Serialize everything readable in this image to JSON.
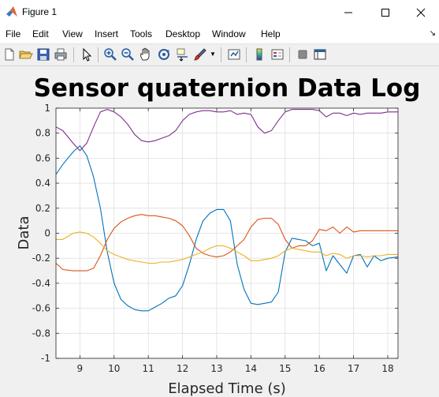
{
  "window": {
    "title": "Figure 1"
  },
  "menu": [
    "File",
    "Edit",
    "View",
    "Insert",
    "Tools",
    "Desktop",
    "Window",
    "Help"
  ],
  "toolbar": {
    "icons": [
      "new-figure-icon",
      "open-file-icon",
      "save-icon",
      "print-icon",
      "select-arrow-icon",
      "zoom-in-icon",
      "zoom-out-icon",
      "pan-hand-icon",
      "rotate-3d-icon",
      "data-cursor-icon",
      "brush-icon",
      "link-plot-icon",
      "colorbar-icon",
      "legend-icon",
      "hide-plot-tools-icon",
      "show-plot-tools-icon"
    ]
  },
  "chart_data": {
    "type": "line",
    "title": "Sensor quaternion Data Log",
    "xlabel": "Elapsed Time (s)",
    "ylabel": "Data",
    "xlim": [
      8.3,
      18.3
    ],
    "ylim": [
      -1,
      1
    ],
    "xticks": [
      9,
      10,
      11,
      12,
      13,
      14,
      15,
      16,
      17,
      18
    ],
    "yticks": [
      -1,
      -0.8,
      -0.6,
      -0.4,
      -0.2,
      0,
      0.2,
      0.4,
      0.6,
      0.8,
      1
    ],
    "ytick_labels": [
      "-1",
      "-0.8",
      "-0.6",
      "-0.4",
      "-0.2",
      "0",
      "0.2",
      "0.4",
      "0.6",
      "0.8",
      "1"
    ],
    "grid": true,
    "series": [
      {
        "color": "#0072BD",
        "x": [
          8.3,
          8.5,
          8.8,
          9.0,
          9.2,
          9.4,
          9.6,
          9.8,
          10.0,
          10.2,
          10.4,
          10.6,
          10.8,
          11.0,
          11.2,
          11.4,
          11.6,
          11.8,
          12.0,
          12.2,
          12.4,
          12.6,
          12.8,
          13.0,
          13.2,
          13.4,
          13.6,
          13.8,
          14.0,
          14.2,
          14.4,
          14.6,
          14.8,
          15.0,
          15.2,
          15.4,
          15.6,
          15.8,
          16.0,
          16.2,
          16.4,
          16.6,
          16.8,
          17.0,
          17.2,
          17.4,
          17.6,
          17.8,
          18.0,
          18.3
        ],
        "y": [
          0.47,
          0.55,
          0.65,
          0.7,
          0.62,
          0.45,
          0.2,
          -0.15,
          -0.4,
          -0.53,
          -0.58,
          -0.61,
          -0.62,
          -0.62,
          -0.59,
          -0.56,
          -0.52,
          -0.5,
          -0.42,
          -0.25,
          -0.05,
          0.1,
          0.16,
          0.19,
          0.19,
          0.1,
          -0.25,
          -0.45,
          -0.56,
          -0.57,
          -0.56,
          -0.55,
          -0.47,
          -0.15,
          -0.04,
          -0.05,
          -0.06,
          -0.1,
          -0.08,
          -0.3,
          -0.18,
          -0.25,
          -0.32,
          -0.18,
          -0.17,
          -0.27,
          -0.18,
          -0.22,
          -0.2,
          -0.19
        ]
      },
      {
        "color": "#D95319",
        "x": [
          8.3,
          8.5,
          8.8,
          9.0,
          9.2,
          9.4,
          9.6,
          9.8,
          10.0,
          10.2,
          10.4,
          10.6,
          10.8,
          11.0,
          11.2,
          11.4,
          11.6,
          11.8,
          12.0,
          12.2,
          12.4,
          12.6,
          12.8,
          13.0,
          13.2,
          13.4,
          13.6,
          13.8,
          14.0,
          14.2,
          14.4,
          14.6,
          14.8,
          15.0,
          15.2,
          15.4,
          15.6,
          15.8,
          16.0,
          16.2,
          16.4,
          16.6,
          16.8,
          17.0,
          17.2,
          17.4,
          17.6,
          17.8,
          18.0,
          18.3
        ],
        "y": [
          -0.24,
          -0.29,
          -0.3,
          -0.3,
          -0.3,
          -0.28,
          -0.18,
          -0.05,
          0.04,
          0.09,
          0.12,
          0.14,
          0.15,
          0.14,
          0.14,
          0.13,
          0.12,
          0.1,
          0.06,
          -0.02,
          -0.12,
          -0.16,
          -0.18,
          -0.19,
          -0.18,
          -0.15,
          -0.1,
          -0.05,
          0.05,
          0.11,
          0.12,
          0.12,
          0.07,
          -0.05,
          -0.12,
          -0.1,
          -0.1,
          -0.06,
          0.03,
          0.02,
          0.05,
          0.0,
          0.05,
          0.01,
          0.02,
          0.02,
          0.02,
          0.02,
          0.02,
          0.02
        ]
      },
      {
        "color": "#EDB120",
        "x": [
          8.3,
          8.5,
          8.8,
          9.0,
          9.2,
          9.4,
          9.6,
          9.8,
          10.0,
          10.2,
          10.4,
          10.6,
          10.8,
          11.0,
          11.2,
          11.4,
          11.6,
          11.8,
          12.0,
          12.2,
          12.4,
          12.6,
          12.8,
          13.0,
          13.2,
          13.4,
          13.6,
          13.8,
          14.0,
          14.2,
          14.4,
          14.6,
          14.8,
          15.0,
          15.2,
          15.4,
          15.6,
          15.8,
          16.0,
          16.2,
          16.4,
          16.6,
          16.8,
          17.0,
          17.2,
          17.4,
          17.6,
          17.8,
          18.0,
          18.3
        ],
        "y": [
          -0.05,
          -0.05,
          0.0,
          0.01,
          0.0,
          -0.03,
          -0.08,
          -0.14,
          -0.17,
          -0.19,
          -0.21,
          -0.22,
          -0.23,
          -0.24,
          -0.24,
          -0.23,
          -0.23,
          -0.22,
          -0.21,
          -0.19,
          -0.17,
          -0.15,
          -0.12,
          -0.1,
          -0.1,
          -0.12,
          -0.15,
          -0.18,
          -0.22,
          -0.22,
          -0.21,
          -0.2,
          -0.18,
          -0.14,
          -0.12,
          -0.13,
          -0.14,
          -0.15,
          -0.15,
          -0.18,
          -0.16,
          -0.17,
          -0.2,
          -0.18,
          -0.18,
          -0.19,
          -0.18,
          -0.18,
          -0.17,
          -0.17
        ]
      },
      {
        "color": "#7E2F8E",
        "x": [
          8.3,
          8.5,
          8.8,
          9.0,
          9.2,
          9.4,
          9.6,
          9.8,
          10.0,
          10.2,
          10.4,
          10.6,
          10.8,
          11.0,
          11.2,
          11.4,
          11.6,
          11.8,
          12.0,
          12.2,
          12.4,
          12.6,
          12.8,
          13.0,
          13.2,
          13.4,
          13.6,
          13.8,
          14.0,
          14.2,
          14.4,
          14.6,
          14.8,
          15.0,
          15.2,
          15.4,
          15.6,
          15.8,
          16.0,
          16.2,
          16.4,
          16.6,
          16.8,
          17.0,
          17.2,
          17.4,
          17.6,
          17.8,
          18.0,
          18.3
        ],
        "y": [
          0.85,
          0.82,
          0.72,
          0.66,
          0.72,
          0.85,
          0.97,
          0.99,
          0.97,
          0.93,
          0.87,
          0.79,
          0.74,
          0.73,
          0.74,
          0.76,
          0.78,
          0.82,
          0.9,
          0.95,
          0.97,
          0.98,
          0.98,
          0.97,
          0.97,
          0.98,
          0.95,
          0.96,
          0.95,
          0.85,
          0.8,
          0.82,
          0.9,
          0.97,
          0.99,
          0.99,
          0.99,
          0.99,
          0.98,
          0.93,
          0.96,
          0.96,
          0.94,
          0.96,
          0.95,
          0.96,
          0.96,
          0.96,
          0.97,
          0.97
        ]
      }
    ]
  }
}
